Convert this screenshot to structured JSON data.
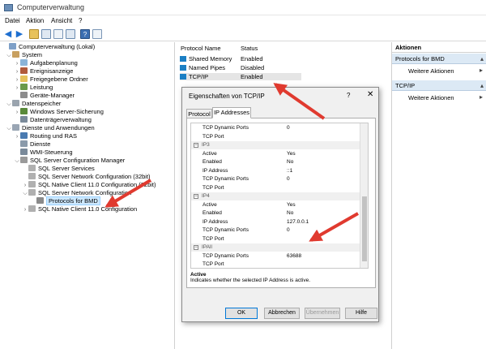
{
  "window": {
    "title": "Computerverwaltung"
  },
  "menu": [
    "Datei",
    "Aktion",
    "Ansicht",
    "?"
  ],
  "tree": [
    {
      "label": "Computerverwaltung (Lokal)",
      "chev": ""
    },
    {
      "label": "System",
      "chev": "⌵"
    },
    {
      "label": "Aufgabenplanung",
      "chev": "›"
    },
    {
      "label": "Ereignisanzeige",
      "chev": "›"
    },
    {
      "label": "Freigegebene Ordner",
      "chev": "›"
    },
    {
      "label": "Leistung",
      "chev": "›"
    },
    {
      "label": "Geräte-Manager",
      "chev": ""
    },
    {
      "label": "Datenspeicher",
      "chev": "⌵"
    },
    {
      "label": "Windows Server-Sicherung",
      "chev": "›"
    },
    {
      "label": "Datenträgerverwaltung",
      "chev": ""
    },
    {
      "label": "Dienste und Anwendungen",
      "chev": "⌵"
    },
    {
      "label": "Routing und RAS",
      "chev": "›"
    },
    {
      "label": "Dienste",
      "chev": ""
    },
    {
      "label": "WMI-Steuerung",
      "chev": ""
    },
    {
      "label": "SQL Server Configuration Manager",
      "chev": "⌵"
    },
    {
      "label": "SQL Server Services",
      "chev": ""
    },
    {
      "label": "SQL Server Network Configuration (32bit)",
      "chev": ""
    },
    {
      "label": "SQL Native Client 11.0 Configuration (32bit)",
      "chev": "›"
    },
    {
      "label": "SQL Server Network Configuration",
      "chev": "⌵"
    },
    {
      "label": "Protocols for BMD",
      "chev": ""
    },
    {
      "label": "SQL Native Client 11.0 Configuration",
      "chev": "›"
    }
  ],
  "middle": {
    "col_name": "Protocol Name",
    "col_status": "Status",
    "rows": [
      {
        "name": "Shared Memory",
        "status": "Enabled"
      },
      {
        "name": "Named Pipes",
        "status": "Disabled"
      },
      {
        "name": "TCP/IP",
        "status": "Enabled"
      }
    ]
  },
  "actions": {
    "header": "Aktionen",
    "sections": [
      {
        "title": "Protocols for BMD",
        "item": "Weitere Aktionen"
      },
      {
        "title": "TCP/IP",
        "item": "Weitere Aktionen"
      }
    ]
  },
  "dialog": {
    "title": "Eigenschaften von TCP/IP",
    "help": "?",
    "close": "✕",
    "tabs": [
      "Protocol",
      "IP Addresses"
    ],
    "props": [
      {
        "type": "row",
        "k": "TCP Dynamic Ports",
        "v": "0"
      },
      {
        "type": "row",
        "k": "TCP Port",
        "v": ""
      },
      {
        "type": "grp",
        "k": "IP3"
      },
      {
        "type": "row",
        "k": "Active",
        "v": "Yes"
      },
      {
        "type": "row",
        "k": "Enabled",
        "v": "No"
      },
      {
        "type": "row",
        "k": "IP Address",
        "v": "::1"
      },
      {
        "type": "row",
        "k": "TCP Dynamic Ports",
        "v": "0"
      },
      {
        "type": "row",
        "k": "TCP Port",
        "v": ""
      },
      {
        "type": "grp",
        "k": "IP4"
      },
      {
        "type": "row",
        "k": "Active",
        "v": "Yes"
      },
      {
        "type": "row",
        "k": "Enabled",
        "v": "No"
      },
      {
        "type": "row",
        "k": "IP Address",
        "v": "127.0.0.1"
      },
      {
        "type": "row",
        "k": "TCP Dynamic Ports",
        "v": "0"
      },
      {
        "type": "row",
        "k": "TCP Port",
        "v": ""
      },
      {
        "type": "grp",
        "k": "IPAll"
      },
      {
        "type": "row",
        "k": "TCP Dynamic Ports",
        "v": "63688"
      },
      {
        "type": "row",
        "k": "TCP Port",
        "v": ""
      }
    ],
    "desc_title": "Active",
    "desc_text": "Indicates whether the selected IP Address is active.",
    "buttons": {
      "ok": "OK",
      "cancel": "Abbrechen",
      "apply": "Übernehmen",
      "help": "Hilfe"
    }
  },
  "colors": {
    "accent": "#e03a2f",
    "selection": "#cce8ff",
    "action_header": "#dce9f5"
  }
}
